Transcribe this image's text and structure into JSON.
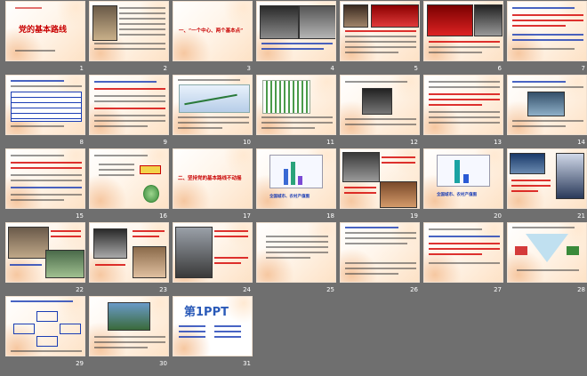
{
  "view": "slide-sorter",
  "slides": [
    {
      "n": "1"
    },
    {
      "n": "2"
    },
    {
      "n": "3"
    },
    {
      "n": "4"
    },
    {
      "n": "5"
    },
    {
      "n": "6"
    },
    {
      "n": "7"
    },
    {
      "n": "8"
    },
    {
      "n": "9"
    },
    {
      "n": "10"
    },
    {
      "n": "11"
    },
    {
      "n": "12"
    },
    {
      "n": "13"
    },
    {
      "n": "14"
    },
    {
      "n": "15"
    },
    {
      "n": "16"
    },
    {
      "n": "17"
    },
    {
      "n": "18"
    },
    {
      "n": "19"
    },
    {
      "n": "20"
    },
    {
      "n": "21"
    },
    {
      "n": "22"
    },
    {
      "n": "23"
    },
    {
      "n": "24"
    },
    {
      "n": "25"
    },
    {
      "n": "26"
    },
    {
      "n": "27"
    },
    {
      "n": "28"
    },
    {
      "n": "29"
    },
    {
      "n": "30"
    },
    {
      "n": "31"
    }
  ],
  "texts": {
    "s1_title": "党的基本路线",
    "s3_title": "一、“一个中心、两个基本点”",
    "s17_title": "二、坚持党的基本路线不动摇",
    "s18_caption": "全国城市、农村产值图",
    "s20_caption": "全国城市、农村产值图",
    "s31_logo": "第1PPT"
  },
  "colors": {
    "accent_red": "#c80000",
    "accent_blue": "#1a3db5",
    "background": "#6f6f6f"
  }
}
